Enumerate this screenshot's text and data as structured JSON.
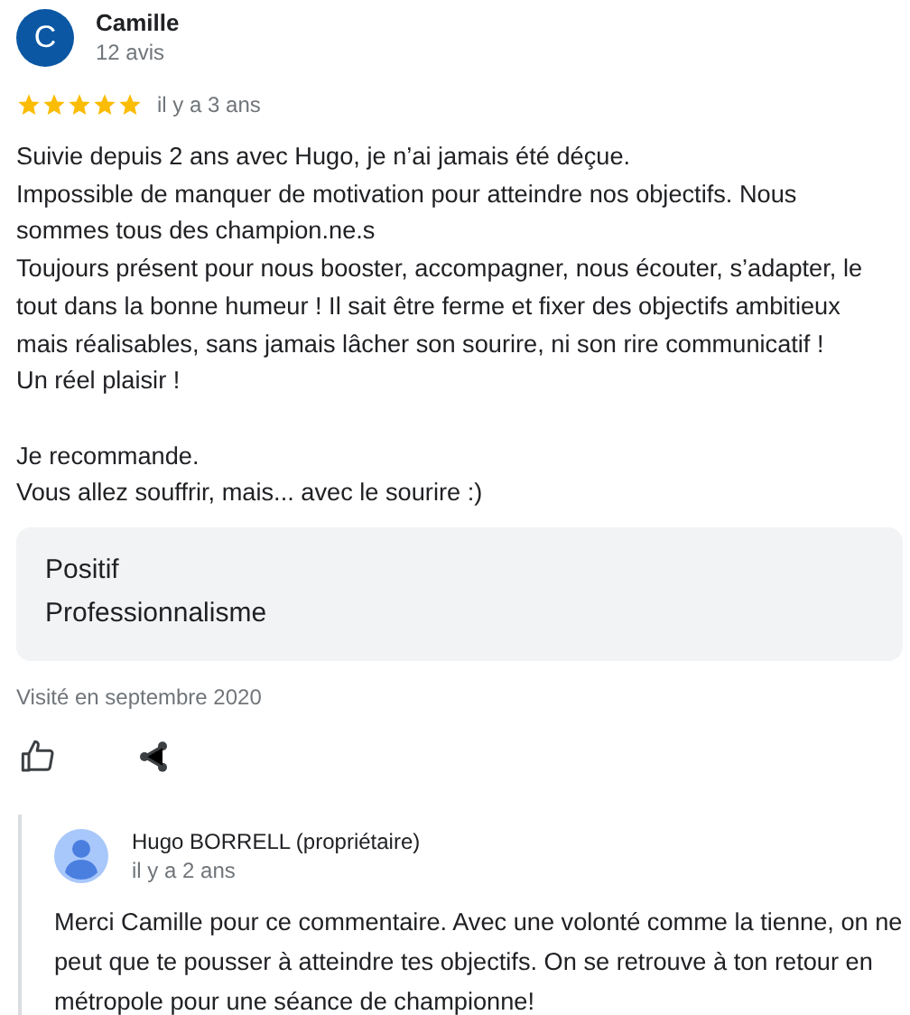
{
  "review": {
    "initial": "C",
    "name": "Camille",
    "count": "12 avis",
    "stars": 5,
    "time": "il y a 3 ans",
    "text": "Suivie depuis 2 ans avec Hugo, je n’ai jamais été déçue.\nImpossible de manquer de motivation pour atteindre nos objectifs. Nous sommes tous des champion.ne.s\nToujours présent pour nous booster, accompagner, nous écouter, s’adapter, le tout dans la bonne humeur ! Il sait être ferme et fixer des objectifs ambitieux mais réalisables, sans jamais lâcher son sourire, ni son rire communicatif !\nUn réel plaisir !\n\nJe recommande.\nVous allez souffrir, mais... avec le sourire :)",
    "attributes": [
      "Positif",
      "Professionnalisme"
    ],
    "visited": "Visité en septembre 2020"
  },
  "reply": {
    "author": "Hugo BORRELL (propriétaire)",
    "time": "il y a 2 ans",
    "text": "Merci Camille pour ce commentaire. Avec une volonté comme la tienne, on ne peut que te pousser à atteindre tes objectifs. On se retrouve à ton retour en métropole pour une séance de championne!"
  }
}
